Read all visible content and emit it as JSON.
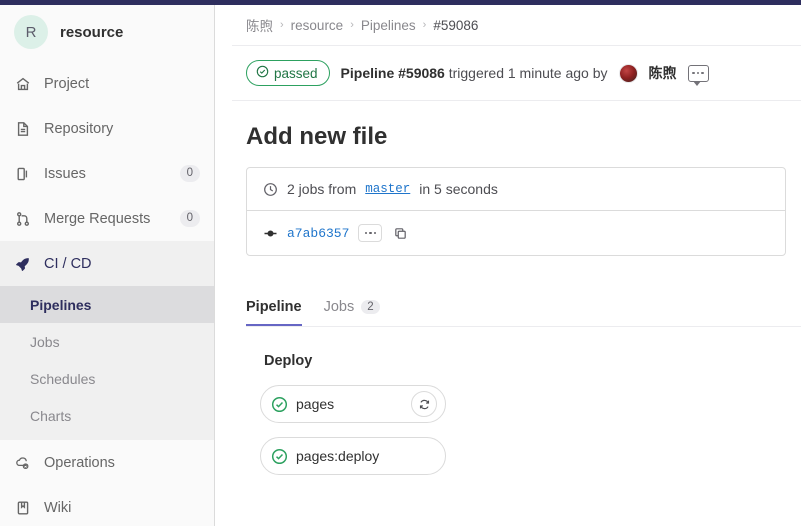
{
  "sidebar": {
    "project": {
      "avatar_letter": "R",
      "name": "resource",
      "avatar_color": "#dcf0e8"
    },
    "items": [
      {
        "label": "Project",
        "icon": "home-icon",
        "badge": ""
      },
      {
        "label": "Repository",
        "icon": "document-icon",
        "badge": ""
      },
      {
        "label": "Issues",
        "icon": "issues-icon",
        "badge": "0"
      },
      {
        "label": "Merge Requests",
        "icon": "merge-request-icon",
        "badge": "0"
      },
      {
        "label": "CI / CD",
        "icon": "rocket-icon",
        "badge": "",
        "active": true
      },
      {
        "label": "Operations",
        "icon": "cloud-gear-icon",
        "badge": ""
      },
      {
        "label": "Wiki",
        "icon": "book-icon",
        "badge": ""
      }
    ],
    "subnav": [
      {
        "label": "Pipelines",
        "active": true
      },
      {
        "label": "Jobs",
        "active": false
      },
      {
        "label": "Schedules",
        "active": false
      },
      {
        "label": "Charts",
        "active": false
      }
    ]
  },
  "breadcrumb": {
    "items": [
      "陈煦",
      "resource",
      "Pipelines",
      "#59086"
    ],
    "separator": "›"
  },
  "status": {
    "badge_label": "passed",
    "badge_icon": "check-circle-icon",
    "badge_color": "#217645",
    "prefix": "Pipeline ",
    "pipeline_id": "#59086",
    "middle": " triggered 1 minute ago by ",
    "user": "陈煦",
    "comment_icon": "comment-icon"
  },
  "commit": {
    "title": "Add new file",
    "jobs_info_prefix": "2 jobs from ",
    "ref": "master",
    "jobs_info_suffix": " in 5 seconds",
    "clock_icon": "clock-icon",
    "commit_icon": "commit-node-icon",
    "sha": "a7ab6357",
    "ellipsis_label": "...",
    "copy_icon": "copy-icon"
  },
  "tabs": [
    {
      "label": "Pipeline",
      "count": "",
      "active": true
    },
    {
      "label": "Jobs",
      "count": "2",
      "active": false
    }
  ],
  "pipeline_graph": {
    "stages": [
      {
        "name": "Deploy",
        "jobs": [
          {
            "name": "pages",
            "status": "success",
            "status_icon": "status-success-icon",
            "retry_icon": "retry-icon",
            "has_retry": true
          },
          {
            "name": "pages:deploy",
            "status": "success",
            "status_icon": "status-success-icon",
            "has_retry": false
          }
        ]
      }
    ]
  }
}
